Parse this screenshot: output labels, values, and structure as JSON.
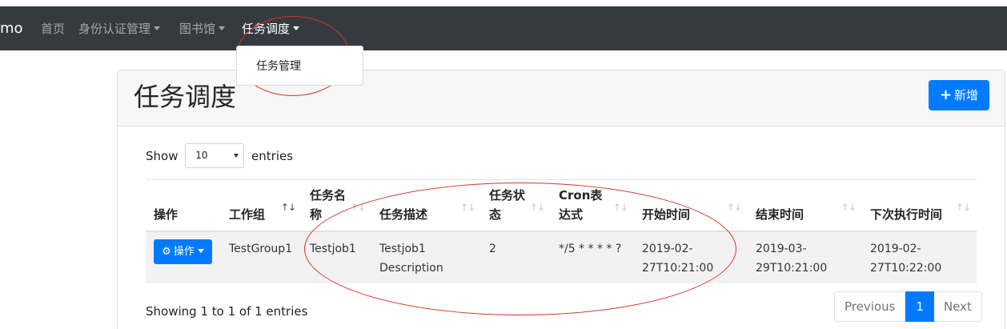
{
  "navbar": {
    "brand": "mo",
    "items": [
      {
        "label": "首页"
      },
      {
        "label": "身份认证管理"
      },
      {
        "label": "图书馆"
      },
      {
        "label": "任务调度"
      }
    ],
    "dropdown": {
      "item": "任务管理"
    }
  },
  "page": {
    "title": "任务调度",
    "add_label": "新增",
    "length": {
      "show": "Show",
      "value": "10",
      "entries": "entries"
    }
  },
  "table": {
    "columns": [
      {
        "label": "操作"
      },
      {
        "label": "工作组"
      },
      {
        "label": "任务名称"
      },
      {
        "label": "任务描述"
      },
      {
        "label": "任务状态"
      },
      {
        "label": "Cron表达式"
      },
      {
        "label": "开始时间"
      },
      {
        "label": "结束时间"
      },
      {
        "label": "下次执行时间"
      }
    ],
    "rows": [
      {
        "action": "操作",
        "group": "TestGroup1",
        "name": "Testjob1",
        "description": "Testjob1 Description",
        "status": "2",
        "cron": "*/5 * * * * ?",
        "start": "2019-02-27T10:21:00",
        "end": "2019-03-29T10:21:00",
        "next": "2019-02-27T10:22:00"
      }
    ]
  },
  "footer": {
    "info": "Showing 1 to 1 of 1 entries",
    "previous": "Previous",
    "current_page": "1",
    "next": "Next"
  },
  "colors": {
    "navbar": "#343a40",
    "primary": "#007bff",
    "annotation": "#d6322b"
  }
}
